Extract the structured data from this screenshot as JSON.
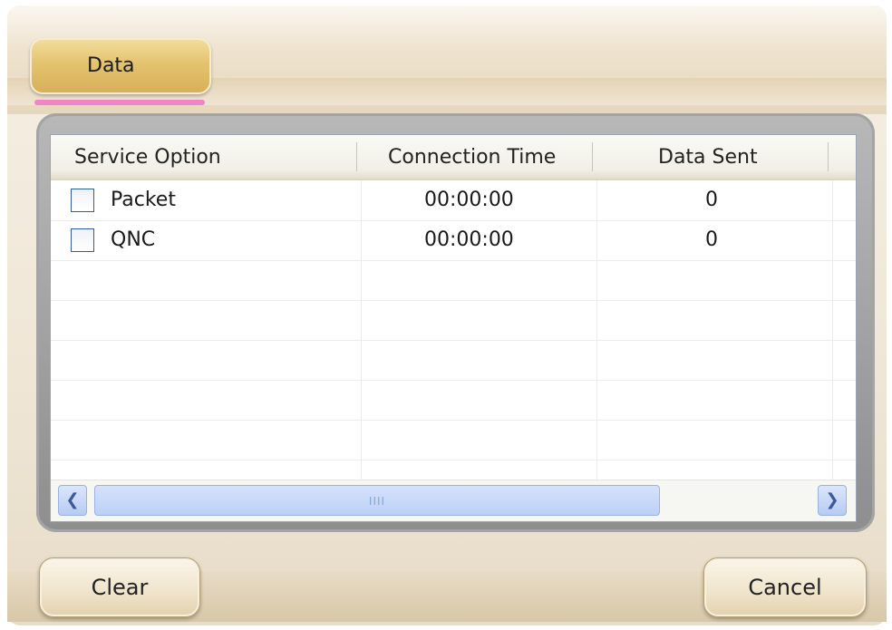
{
  "tabs": [
    {
      "label": "Data",
      "active": true
    }
  ],
  "table": {
    "columns": [
      "Service Option",
      "Connection Time",
      "Data Sent"
    ],
    "rows": [
      {
        "option": "Packet",
        "checked": false,
        "connection_time": "00:00:00",
        "data_sent": "0"
      },
      {
        "option": "QNC",
        "checked": false,
        "connection_time": "00:00:00",
        "data_sent": "0"
      }
    ],
    "scrollbar": {
      "thumb_grip": "IIII"
    }
  },
  "buttons": {
    "clear": "Clear",
    "cancel": "Cancel"
  },
  "icons": {
    "scroll_left": "scroll-left-arrow-icon",
    "scroll_right": "scroll-right-arrow-icon"
  },
  "colors": {
    "tab_active": "#e4c36f",
    "tab_indicator": "#f084c8",
    "checkbox_border": "#2e5f97"
  }
}
